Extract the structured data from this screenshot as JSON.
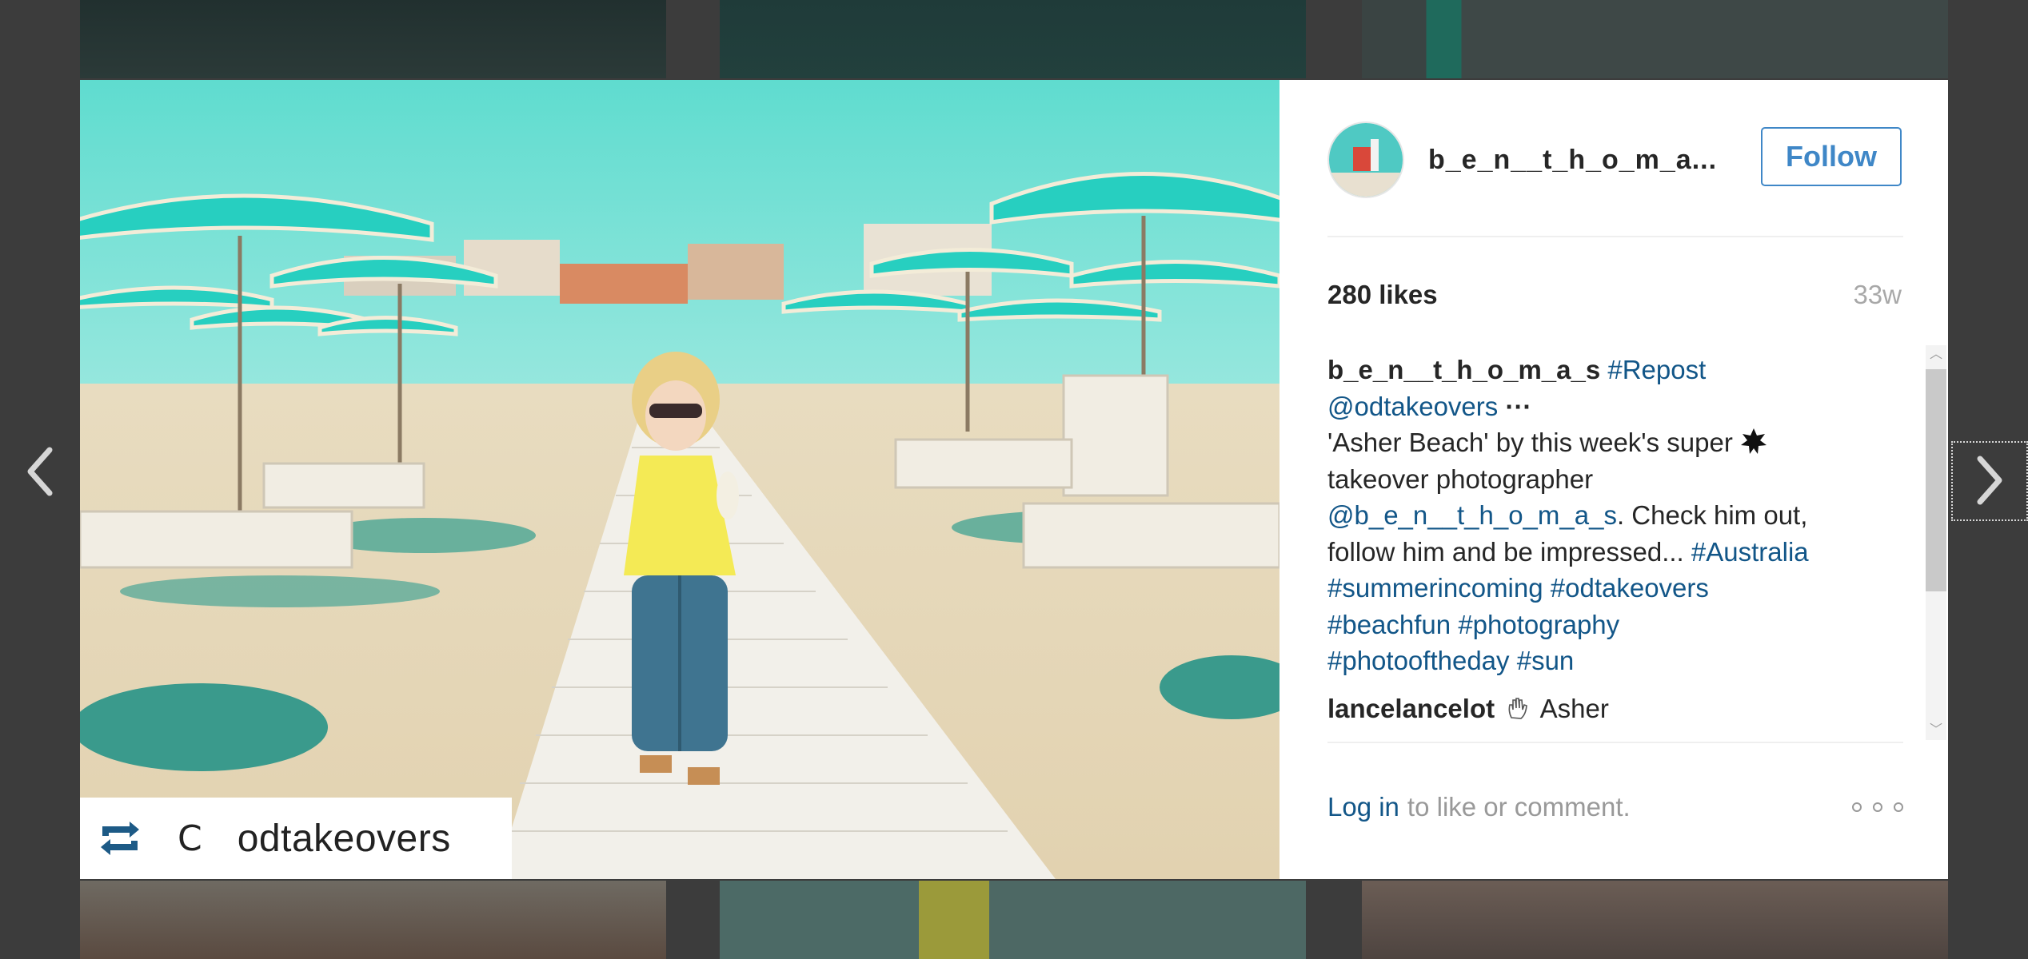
{
  "header": {
    "username": "b_e_n__t_h_o_m_a...",
    "follow_label": "Follow"
  },
  "stats": {
    "likes": "280 likes",
    "time_ago": "33w"
  },
  "caption": {
    "user": "b_e_n__t_h_o_m_a_s",
    "lines": [
      {
        "tags": [
          "#Repost"
        ]
      },
      {
        "mention": "@odtakeovers",
        "ellipsis": "···"
      },
      {
        "text": "'Asher Beach' by this week's super",
        "emoji": "star-icon"
      },
      {
        "text": "takeover photographer"
      },
      {
        "mention": "@b_e_n__t_h_o_m_a_s",
        "text": ". Check him out,"
      },
      {
        "text": "follow him and be impressed... ",
        "tag": "#Australia"
      },
      {
        "tags": [
          "#summerincoming",
          "#odtakeovers"
        ]
      },
      {
        "tags": [
          "#beachfun",
          "#photography"
        ]
      },
      {
        "tags": [
          "#photooftheday",
          "#sun"
        ]
      }
    ],
    "line_texts": {
      "l1_tag": "#Repost",
      "l2_mention": "@odtakeovers",
      "l2_more": "···",
      "l3_text": "'Asher Beach' by this week's super",
      "l4_text": "takeover photographer",
      "l5_mention": "@b_e_n__t_h_o_m_a_s",
      "l5_text": ". Check him out,",
      "l6_text": "follow him and be impressed... ",
      "l6_tag": "#Australia",
      "l7_tag1": "#summerincoming",
      "l7_tag2": "#odtakeovers",
      "l8_tag1": "#beachfun",
      "l8_tag2": "#photography",
      "l9_tag1": "#photooftheday",
      "l9_tag2": "#sun"
    }
  },
  "comment": {
    "user": "lancelancelot",
    "text": "Asher",
    "emoji": "wave-hand-icon"
  },
  "footer": {
    "login_label": "Log in",
    "prompt": "to like or comment."
  },
  "repost_badge": {
    "bracket": "С",
    "user": "odtakeovers"
  },
  "colors": {
    "link": "#125688",
    "follow": "#3f87c7",
    "sky": "#6fdcd0",
    "umbrella": "#27cfc0"
  }
}
